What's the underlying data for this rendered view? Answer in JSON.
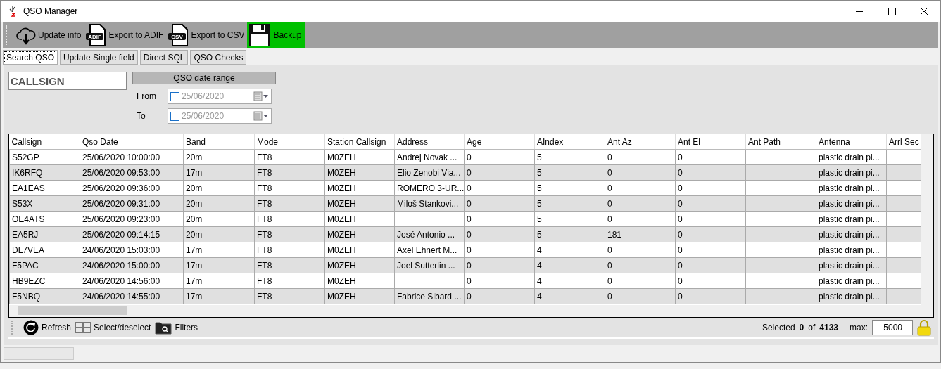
{
  "window": {
    "title": "QSO Manager"
  },
  "toolbar": [
    {
      "label": "Update info",
      "kind": "download",
      "active": false
    },
    {
      "label": "Export to ADIF",
      "kind": "file",
      "badge": "ADIF",
      "active": false
    },
    {
      "label": "Export to CSV",
      "kind": "file",
      "badge": "CSV",
      "active": false
    },
    {
      "label": "Backup",
      "kind": "disk",
      "active": true
    }
  ],
  "tabs": [
    {
      "label": "Search QSO",
      "selected": true
    },
    {
      "label": "Update Single field",
      "selected": false
    },
    {
      "label": "Direct SQL",
      "selected": false
    },
    {
      "label": "QSO Checks",
      "selected": false
    }
  ],
  "search": {
    "callsign_placeholder": "CALLSIGN",
    "date_range_title": "QSO date range",
    "dates": [
      {
        "label": "From",
        "value": "25/06/2020",
        "checked": false
      },
      {
        "label": "To",
        "value": "25/06/2020",
        "checked": false
      }
    ]
  },
  "table": {
    "columns": [
      "Callsign",
      "Qso Date",
      "Band",
      "Mode",
      "Station Callsign",
      "Address",
      "Age",
      "AIndex",
      "Ant Az",
      "Ant El",
      "Ant Path",
      "Antenna",
      "Arrl Sec"
    ],
    "rows": [
      [
        "S52GP",
        "25/06/2020 10:00:00",
        "20m",
        "FT8",
        "M0ZEH",
        "Andrej Novak ...",
        "0",
        "5",
        "0",
        "0",
        "",
        "plastic drain pi...",
        ""
      ],
      [
        "IK6RFQ",
        "25/06/2020 09:53:00",
        "17m",
        "FT8",
        "M0ZEH",
        "Elio Zenobi Via...",
        "0",
        "5",
        "0",
        "0",
        "",
        "plastic drain pi...",
        ""
      ],
      [
        "EA1EAS",
        "25/06/2020 09:36:00",
        "20m",
        "FT8",
        "M0ZEH",
        "ROMERO 3-UR...",
        "0",
        "5",
        "0",
        "0",
        "",
        "plastic drain pi...",
        ""
      ],
      [
        "S53X",
        "25/06/2020 09:31:00",
        "20m",
        "FT8",
        "M0ZEH",
        "Miloš Stankovi...",
        "0",
        "5",
        "0",
        "0",
        "",
        "plastic drain pi...",
        ""
      ],
      [
        "OE4ATS",
        "25/06/2020 09:23:00",
        "20m",
        "FT8",
        "M0ZEH",
        "",
        "0",
        "5",
        "0",
        "0",
        "",
        "plastic drain pi...",
        ""
      ],
      [
        "EA5RJ",
        "25/06/2020 09:14:15",
        "20m",
        "FT8",
        "M0ZEH",
        "José Antonio ...",
        "0",
        "5",
        "181",
        "0",
        "",
        "plastic drain pi...",
        ""
      ],
      [
        "DL7VEA",
        "24/06/2020 15:03:00",
        "17m",
        "FT8",
        "M0ZEH",
        "Axel Ehnert M...",
        "0",
        "4",
        "0",
        "0",
        "",
        "plastic drain pi...",
        ""
      ],
      [
        "F5PAC",
        "24/06/2020 15:00:00",
        "17m",
        "FT8",
        "M0ZEH",
        "Joel Sutterlin ...",
        "0",
        "4",
        "0",
        "0",
        "",
        "plastic drain pi...",
        ""
      ],
      [
        "HB9EZC",
        "24/06/2020 14:56:00",
        "17m",
        "FT8",
        "M0ZEH",
        "",
        "0",
        "4",
        "0",
        "0",
        "",
        "plastic drain pi...",
        ""
      ],
      [
        "F5NBQ",
        "24/06/2020 14:55:00",
        "17m",
        "FT8",
        "M0ZEH",
        "Fabrice Sibard ...",
        "0",
        "4",
        "0",
        "0",
        "",
        "plastic drain pi...",
        ""
      ]
    ]
  },
  "bottom_bar": {
    "actions": [
      {
        "label": "Refresh",
        "kind": "refresh"
      },
      {
        "label": "Select/deselect",
        "kind": "grid"
      },
      {
        "label": "Filters",
        "kind": "folder"
      }
    ],
    "selected_label": "Selected",
    "selected_count": "0",
    "of_label": "of",
    "total": "4133",
    "max_label": "max:",
    "max_value": "5000"
  }
}
